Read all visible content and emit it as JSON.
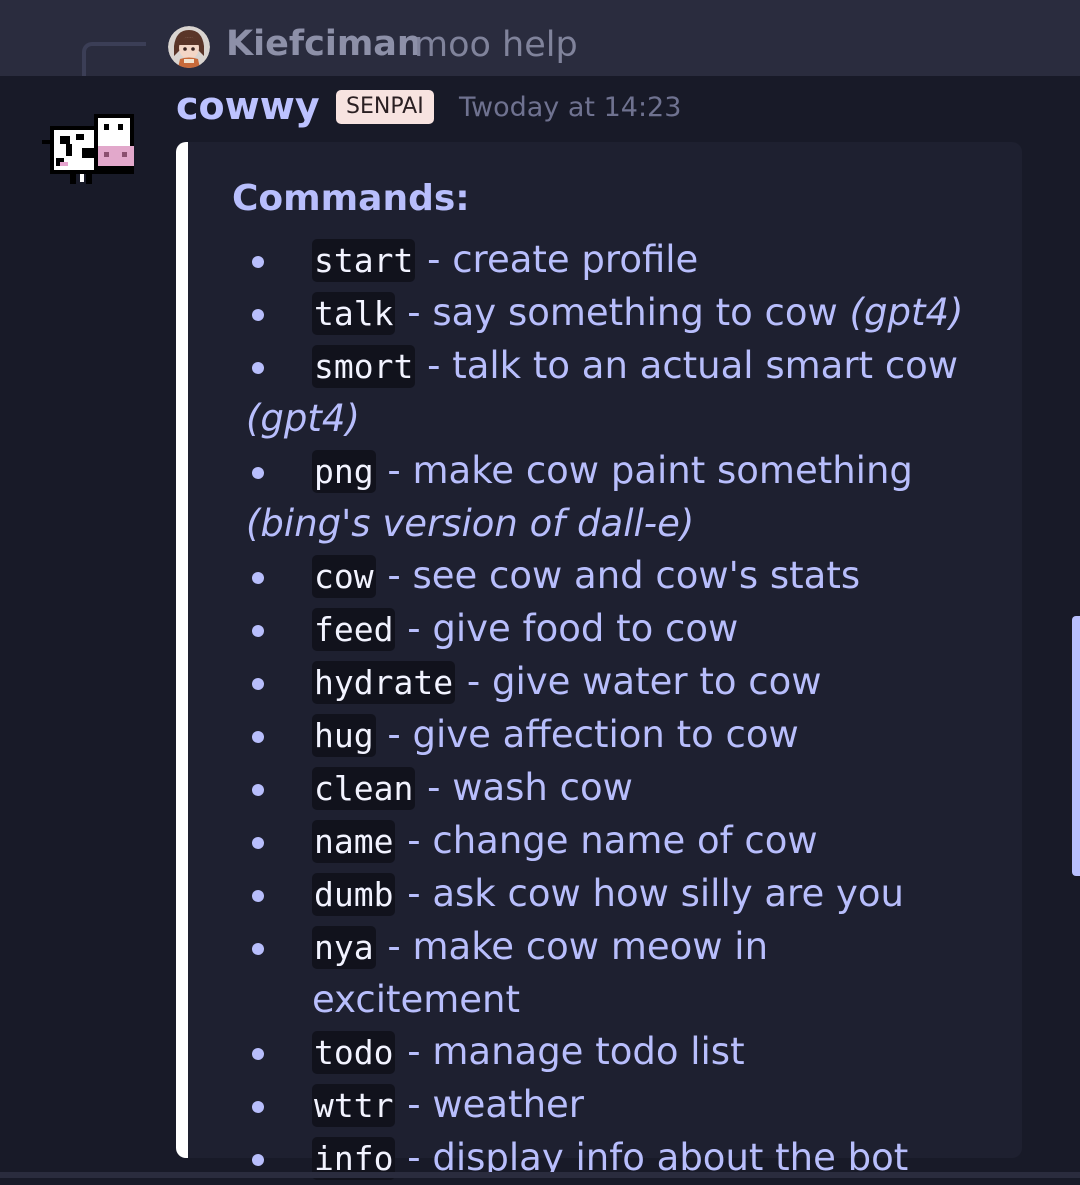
{
  "reply": {
    "author": "Kiefciman",
    "text": "moo help",
    "avatar_icon": "user-avatar"
  },
  "message": {
    "author": "cowwy",
    "role_badge": "SENPAI",
    "timestamp": "Twoday at 14:23",
    "avatar_icon": "cow-pixel-avatar",
    "accent_color": "#b8befc",
    "embed_border_color": "#ffffff"
  },
  "embed": {
    "title": "Commands:",
    "commands": [
      {
        "name": "start",
        "desc": " - create profile",
        "note": ""
      },
      {
        "name": "talk",
        "desc": " - say something to cow ",
        "note": "(gpt4)"
      },
      {
        "name": "smort",
        "desc": " - talk to an actual smart cow ",
        "note": "(gpt4)"
      },
      {
        "name": "png",
        "desc": " - make cow paint something ",
        "note": "(bing's version of dall-e)"
      },
      {
        "name": "cow",
        "desc": " - see cow and cow's stats",
        "note": ""
      },
      {
        "name": "feed",
        "desc": " - give food to cow",
        "note": ""
      },
      {
        "name": "hydrate",
        "desc": " - give water to cow",
        "note": ""
      },
      {
        "name": "hug",
        "desc": " - give affection to cow",
        "note": ""
      },
      {
        "name": "clean",
        "desc": " - wash cow",
        "note": ""
      },
      {
        "name": "name",
        "desc": " - change name of cow",
        "note": ""
      },
      {
        "name": "dumb",
        "desc": " - ask cow how silly are you",
        "note": ""
      },
      {
        "name": "nya",
        "desc": " - make cow meow in excitement",
        "note": ""
      },
      {
        "name": "todo",
        "desc": " - manage todo list",
        "note": ""
      },
      {
        "name": "wttr",
        "desc": " - weather",
        "note": ""
      },
      {
        "name": "info",
        "desc": " - display info about the bot",
        "note": ""
      }
    ]
  }
}
